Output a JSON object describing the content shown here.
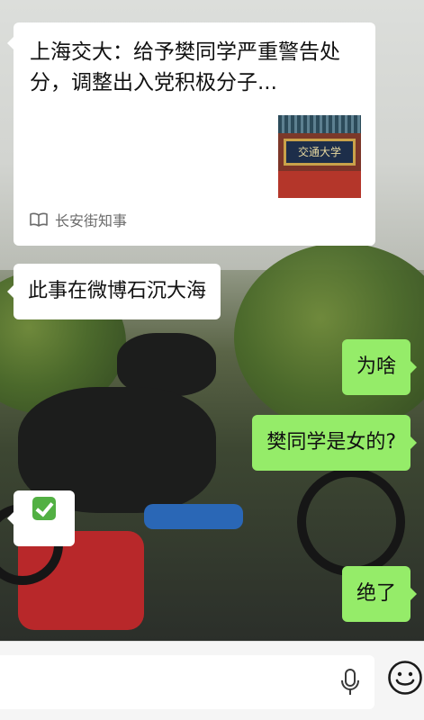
{
  "messages": {
    "card": {
      "title": "上海交大：给予樊同学严重警告处分，调整出入党积极分子...",
      "source": "长安街知事",
      "thumbnail_text": "交通大学"
    },
    "m1": "此事在微博石沉大海",
    "m2": "为啥",
    "m3": "樊同学是女的?",
    "m4": "✅",
    "m5": "绝了"
  },
  "input_bar": {
    "placeholder": ""
  },
  "colors": {
    "outgoing_bubble": "#95ec69",
    "incoming_bubble": "#ffffff",
    "input_bar_bg": "#f5f5f5"
  },
  "icons": {
    "source": "book-icon",
    "voice": "microphone-icon",
    "emoji": "smiley-icon"
  }
}
